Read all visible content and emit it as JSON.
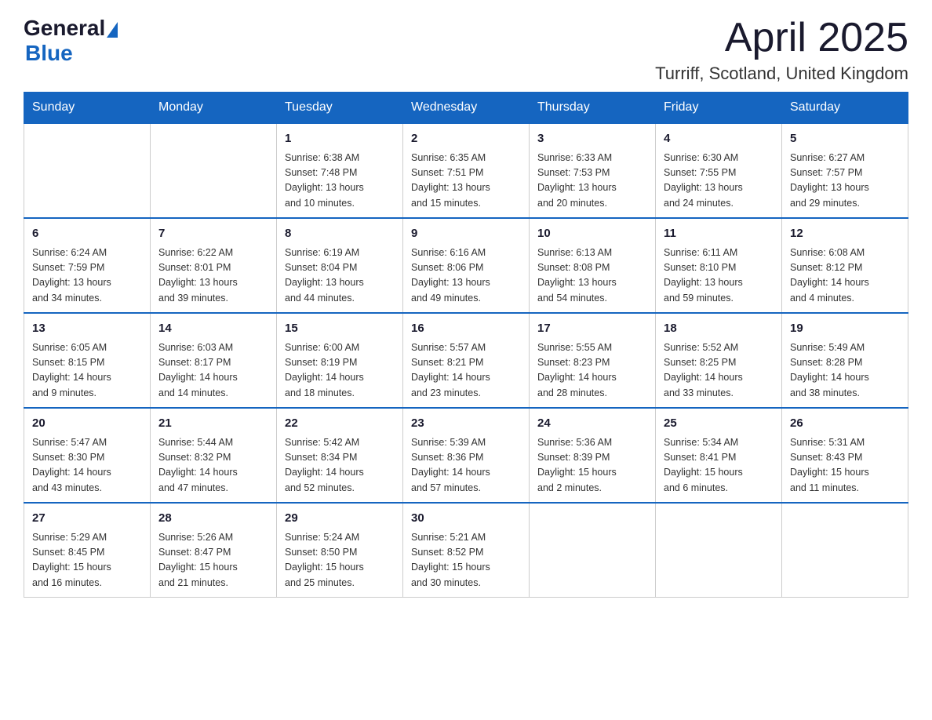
{
  "header": {
    "logo_general": "General",
    "logo_blue": "Blue",
    "month_year": "April 2025",
    "location": "Turriff, Scotland, United Kingdom"
  },
  "weekdays": [
    "Sunday",
    "Monday",
    "Tuesday",
    "Wednesday",
    "Thursday",
    "Friday",
    "Saturday"
  ],
  "weeks": [
    [
      {
        "day": "",
        "info": ""
      },
      {
        "day": "",
        "info": ""
      },
      {
        "day": "1",
        "info": "Sunrise: 6:38 AM\nSunset: 7:48 PM\nDaylight: 13 hours\nand 10 minutes."
      },
      {
        "day": "2",
        "info": "Sunrise: 6:35 AM\nSunset: 7:51 PM\nDaylight: 13 hours\nand 15 minutes."
      },
      {
        "day": "3",
        "info": "Sunrise: 6:33 AM\nSunset: 7:53 PM\nDaylight: 13 hours\nand 20 minutes."
      },
      {
        "day": "4",
        "info": "Sunrise: 6:30 AM\nSunset: 7:55 PM\nDaylight: 13 hours\nand 24 minutes."
      },
      {
        "day": "5",
        "info": "Sunrise: 6:27 AM\nSunset: 7:57 PM\nDaylight: 13 hours\nand 29 minutes."
      }
    ],
    [
      {
        "day": "6",
        "info": "Sunrise: 6:24 AM\nSunset: 7:59 PM\nDaylight: 13 hours\nand 34 minutes."
      },
      {
        "day": "7",
        "info": "Sunrise: 6:22 AM\nSunset: 8:01 PM\nDaylight: 13 hours\nand 39 minutes."
      },
      {
        "day": "8",
        "info": "Sunrise: 6:19 AM\nSunset: 8:04 PM\nDaylight: 13 hours\nand 44 minutes."
      },
      {
        "day": "9",
        "info": "Sunrise: 6:16 AM\nSunset: 8:06 PM\nDaylight: 13 hours\nand 49 minutes."
      },
      {
        "day": "10",
        "info": "Sunrise: 6:13 AM\nSunset: 8:08 PM\nDaylight: 13 hours\nand 54 minutes."
      },
      {
        "day": "11",
        "info": "Sunrise: 6:11 AM\nSunset: 8:10 PM\nDaylight: 13 hours\nand 59 minutes."
      },
      {
        "day": "12",
        "info": "Sunrise: 6:08 AM\nSunset: 8:12 PM\nDaylight: 14 hours\nand 4 minutes."
      }
    ],
    [
      {
        "day": "13",
        "info": "Sunrise: 6:05 AM\nSunset: 8:15 PM\nDaylight: 14 hours\nand 9 minutes."
      },
      {
        "day": "14",
        "info": "Sunrise: 6:03 AM\nSunset: 8:17 PM\nDaylight: 14 hours\nand 14 minutes."
      },
      {
        "day": "15",
        "info": "Sunrise: 6:00 AM\nSunset: 8:19 PM\nDaylight: 14 hours\nand 18 minutes."
      },
      {
        "day": "16",
        "info": "Sunrise: 5:57 AM\nSunset: 8:21 PM\nDaylight: 14 hours\nand 23 minutes."
      },
      {
        "day": "17",
        "info": "Sunrise: 5:55 AM\nSunset: 8:23 PM\nDaylight: 14 hours\nand 28 minutes."
      },
      {
        "day": "18",
        "info": "Sunrise: 5:52 AM\nSunset: 8:25 PM\nDaylight: 14 hours\nand 33 minutes."
      },
      {
        "day": "19",
        "info": "Sunrise: 5:49 AM\nSunset: 8:28 PM\nDaylight: 14 hours\nand 38 minutes."
      }
    ],
    [
      {
        "day": "20",
        "info": "Sunrise: 5:47 AM\nSunset: 8:30 PM\nDaylight: 14 hours\nand 43 minutes."
      },
      {
        "day": "21",
        "info": "Sunrise: 5:44 AM\nSunset: 8:32 PM\nDaylight: 14 hours\nand 47 minutes."
      },
      {
        "day": "22",
        "info": "Sunrise: 5:42 AM\nSunset: 8:34 PM\nDaylight: 14 hours\nand 52 minutes."
      },
      {
        "day": "23",
        "info": "Sunrise: 5:39 AM\nSunset: 8:36 PM\nDaylight: 14 hours\nand 57 minutes."
      },
      {
        "day": "24",
        "info": "Sunrise: 5:36 AM\nSunset: 8:39 PM\nDaylight: 15 hours\nand 2 minutes."
      },
      {
        "day": "25",
        "info": "Sunrise: 5:34 AM\nSunset: 8:41 PM\nDaylight: 15 hours\nand 6 minutes."
      },
      {
        "day": "26",
        "info": "Sunrise: 5:31 AM\nSunset: 8:43 PM\nDaylight: 15 hours\nand 11 minutes."
      }
    ],
    [
      {
        "day": "27",
        "info": "Sunrise: 5:29 AM\nSunset: 8:45 PM\nDaylight: 15 hours\nand 16 minutes."
      },
      {
        "day": "28",
        "info": "Sunrise: 5:26 AM\nSunset: 8:47 PM\nDaylight: 15 hours\nand 21 minutes."
      },
      {
        "day": "29",
        "info": "Sunrise: 5:24 AM\nSunset: 8:50 PM\nDaylight: 15 hours\nand 25 minutes."
      },
      {
        "day": "30",
        "info": "Sunrise: 5:21 AM\nSunset: 8:52 PM\nDaylight: 15 hours\nand 30 minutes."
      },
      {
        "day": "",
        "info": ""
      },
      {
        "day": "",
        "info": ""
      },
      {
        "day": "",
        "info": ""
      }
    ]
  ]
}
